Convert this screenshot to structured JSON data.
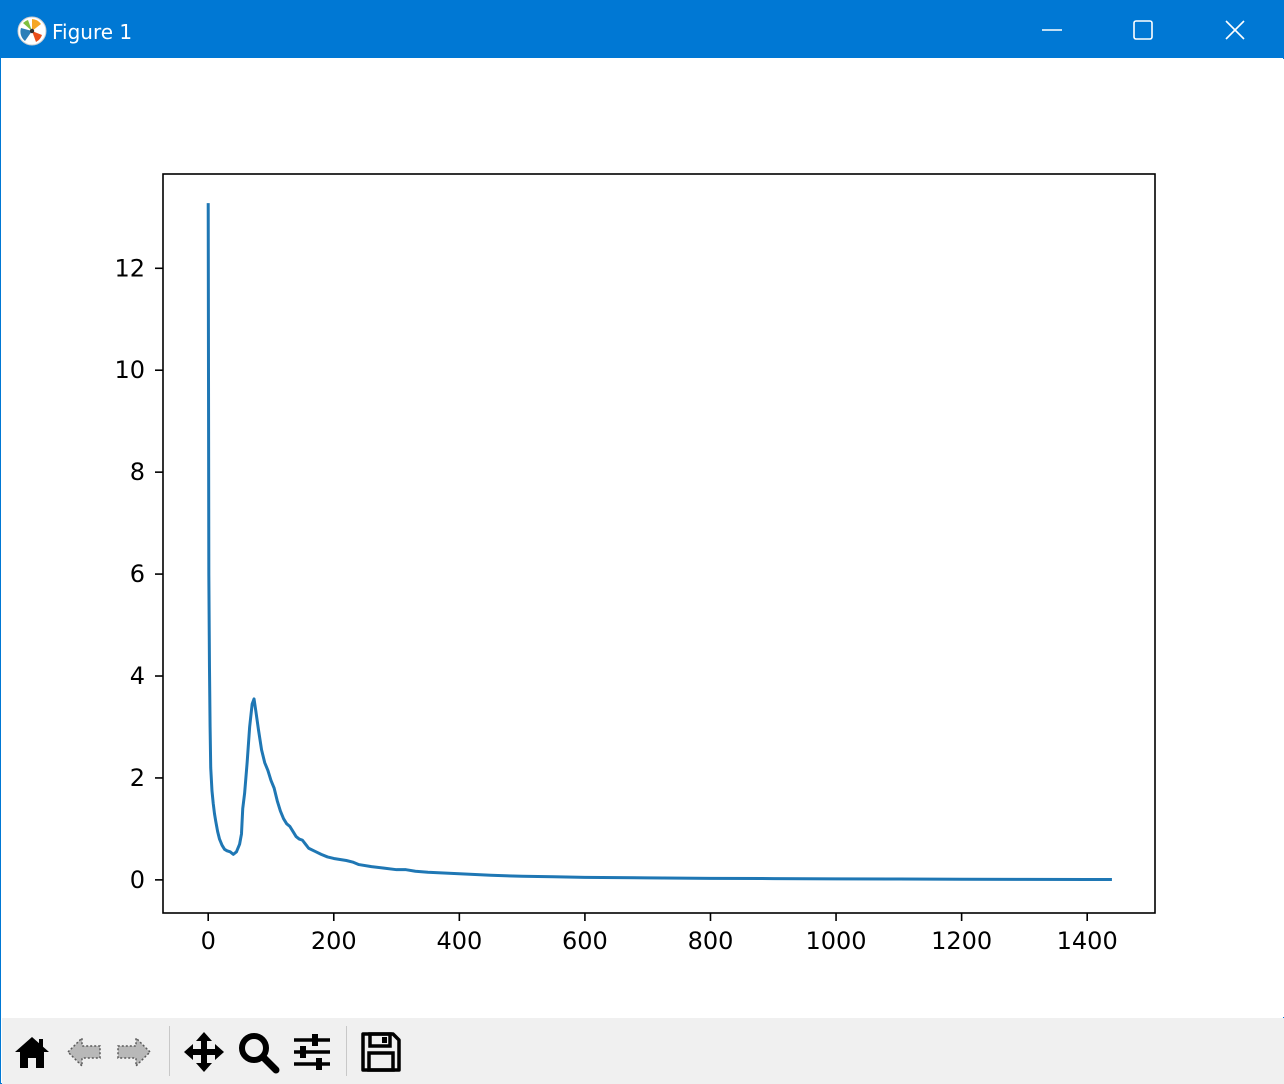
{
  "window": {
    "title": "Figure 1",
    "icons": {
      "app": "matplotlib-logo-icon",
      "minimize": "minimize-icon",
      "maximize": "maximize-icon",
      "close": "close-icon"
    },
    "titlebar_color": "#0078d4"
  },
  "toolbar": {
    "tools": [
      {
        "name": "home",
        "icon": "home-icon"
      },
      {
        "name": "back",
        "icon": "back-arrow-icon",
        "enabled": false
      },
      {
        "name": "forward",
        "icon": "forward-arrow-icon",
        "enabled": false
      },
      {
        "name": "pan",
        "icon": "move-icon"
      },
      {
        "name": "zoom",
        "icon": "zoom-icon"
      },
      {
        "name": "configure-subplots",
        "icon": "sliders-icon"
      },
      {
        "name": "save",
        "icon": "save-icon"
      }
    ]
  },
  "chart_data": {
    "type": "line",
    "title": "",
    "xlabel": "",
    "ylabel": "",
    "xlim": [
      -72,
      1508
    ],
    "ylim": [
      -0.65,
      13.85
    ],
    "xticks": [
      0,
      200,
      400,
      600,
      800,
      1000,
      1200,
      1400
    ],
    "yticks": [
      0,
      2,
      4,
      6,
      8,
      10,
      12
    ],
    "grid": false,
    "legend": false,
    "line_color": "#1f77b4",
    "series": [
      {
        "x": [
          0,
          1,
          2,
          3,
          4,
          6,
          8,
          10,
          12,
          15,
          18,
          22,
          26,
          30,
          35,
          40,
          45,
          50,
          53,
          55,
          58,
          62,
          66,
          70,
          73,
          76,
          80,
          85,
          90,
          95,
          100,
          105,
          110,
          115,
          120,
          125,
          130,
          135,
          140,
          145,
          150,
          155,
          160,
          170,
          180,
          190,
          200,
          210,
          220,
          230,
          240,
          260,
          280,
          300,
          315,
          330,
          350,
          400,
          450,
          500,
          550,
          600,
          700,
          800,
          900,
          1000,
          1100,
          1200,
          1300,
          1400,
          1437
        ],
        "y": [
          13.25,
          6.0,
          4.2,
          3.0,
          2.2,
          1.75,
          1.5,
          1.3,
          1.15,
          0.95,
          0.8,
          0.68,
          0.6,
          0.57,
          0.55,
          0.5,
          0.55,
          0.7,
          0.9,
          1.4,
          1.7,
          2.3,
          3.0,
          3.45,
          3.55,
          3.3,
          2.95,
          2.55,
          2.3,
          2.15,
          1.95,
          1.8,
          1.55,
          1.35,
          1.2,
          1.1,
          1.05,
          0.95,
          0.85,
          0.8,
          0.78,
          0.7,
          0.62,
          0.56,
          0.5,
          0.45,
          0.42,
          0.4,
          0.38,
          0.35,
          0.3,
          0.26,
          0.23,
          0.2,
          0.2,
          0.17,
          0.15,
          0.12,
          0.09,
          0.07,
          0.06,
          0.05,
          0.04,
          0.03,
          0.025,
          0.02,
          0.016,
          0.012,
          0.01,
          0.008,
          0.007
        ]
      }
    ]
  }
}
